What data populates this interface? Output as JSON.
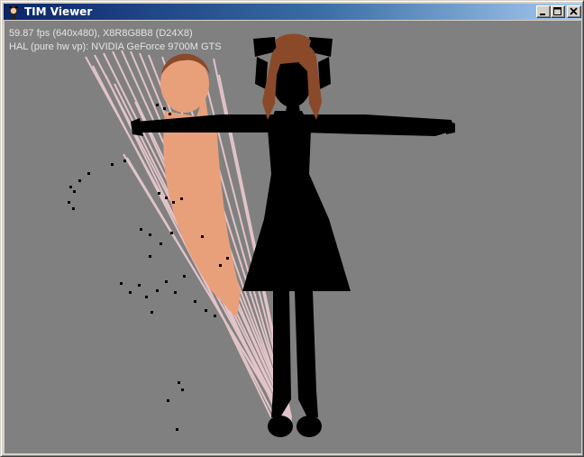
{
  "window": {
    "title": "TIM  Viewer",
    "icon": "character-app-icon",
    "buttons": {
      "minimize": "minimize-icon",
      "maximize": "maximize-icon",
      "close": "close-icon"
    }
  },
  "stats": {
    "fps_line": "59.87 fps (640x480), X8R8G8B8 (D24X8)",
    "device_line": "HAL (pure hw vp): NVIDIA GeForce 9700M GTS"
  },
  "colors": {
    "titlebar_start": "#0a246a",
    "titlebar_end": "#a6caf0",
    "viewport_bg": "#808080",
    "stats_text": "#e4e4e4",
    "silhouette": "#000000",
    "hair": "#8a4a2a",
    "skin": "#e8a07a",
    "streaks": "#e8c8cc"
  }
}
